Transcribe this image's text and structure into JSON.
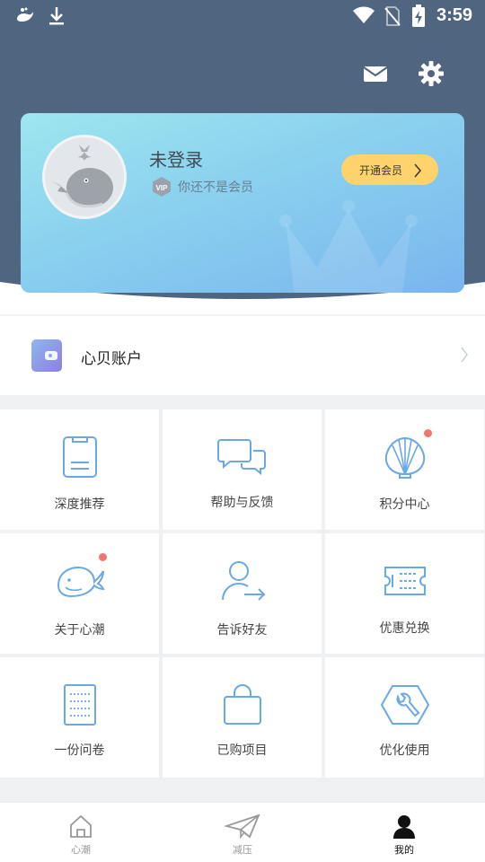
{
  "status_bar": {
    "time": "3:59",
    "icons": [
      "whale-app-icon",
      "download-icon",
      "wifi-icon",
      "no-sim-icon",
      "battery-charging-icon"
    ]
  },
  "header": {
    "actions": [
      "mail-icon",
      "settings-gear-icon"
    ]
  },
  "profile": {
    "name": "未登录",
    "vip_badge": "VIP",
    "vip_status": "你还不是会员",
    "open_vip_label": "开通会员"
  },
  "account": {
    "label": "心贝账户"
  },
  "grid": {
    "items": [
      {
        "label": "深度推荐",
        "icon": "clipboard-icon"
      },
      {
        "label": "帮助与反馈",
        "icon": "chat-bubbles-icon"
      },
      {
        "label": "积分中心",
        "icon": "shell-icon",
        "has_dot": true
      },
      {
        "label": "关于心潮",
        "icon": "whale-icon",
        "has_dot": true
      },
      {
        "label": "告诉好友",
        "icon": "share-user-icon"
      },
      {
        "label": "优惠兑换",
        "icon": "ticket-icon"
      },
      {
        "label": "一份问卷",
        "icon": "survey-icon"
      },
      {
        "label": "已购项目",
        "icon": "shopping-bag-icon"
      },
      {
        "label": "优化使用",
        "icon": "wrench-icon"
      }
    ]
  },
  "tabbar": {
    "tabs": [
      {
        "label": "心潮",
        "icon": "home-icon",
        "active": false
      },
      {
        "label": "减压",
        "icon": "paper-plane-icon",
        "active": false
      },
      {
        "label": "我的",
        "icon": "user-icon",
        "active": true
      }
    ]
  },
  "colors": {
    "header": "#4f6580",
    "accent": "#6aa8e6",
    "vip_button": "#ffd36b",
    "dot": "#f07770"
  }
}
